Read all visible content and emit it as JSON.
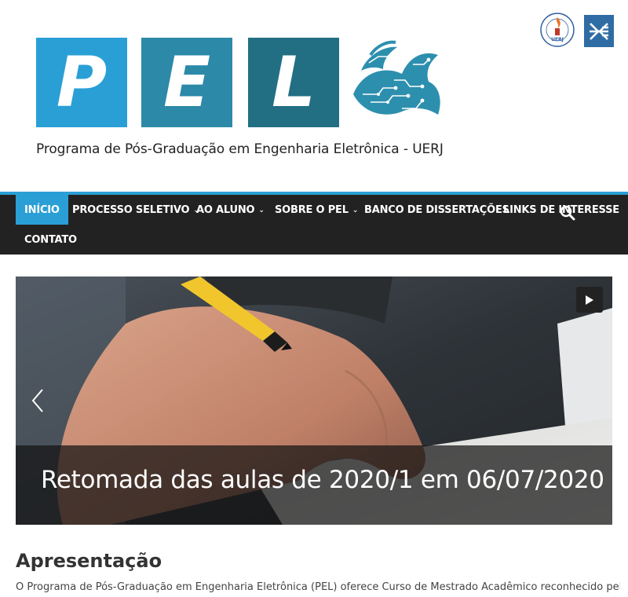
{
  "header": {
    "logo_letters": [
      "P",
      "E",
      "L"
    ],
    "subtitle": "Programa de Pós-Graduação em Engenharia Eletrônica - UERJ",
    "partner_logos": [
      "uerj-seal",
      "cte-logo"
    ],
    "uerj_seal_text": "UERJ",
    "colors": {
      "p": "#2a9fd6",
      "e": "#2c89a8",
      "l": "#226f84"
    }
  },
  "nav": {
    "items": [
      {
        "label": "INÍCIO",
        "active": true,
        "has_dropdown": false
      },
      {
        "label": "PROCESSO SELETIVO",
        "active": false,
        "has_dropdown": true
      },
      {
        "label": "AO ALUNO",
        "active": false,
        "has_dropdown": true
      },
      {
        "label": "SOBRE O PEL",
        "active": false,
        "has_dropdown": true
      },
      {
        "label": "BANCO DE DISSERTAÇÕES",
        "active": false,
        "has_dropdown": false
      },
      {
        "label": "LINKS DE INTERESSE",
        "active": false,
        "has_dropdown": false
      },
      {
        "label": "CONTATO",
        "active": false,
        "has_dropdown": false
      }
    ],
    "dropdown_glyph": "⌄",
    "search_icon": "search-icon",
    "accent": "#2a9fd6",
    "background": "#222222"
  },
  "slider": {
    "caption": "Retomada das aulas de 2020/1 em 06/07/2020",
    "controls": [
      "prev-arrow-icon",
      "play-icon"
    ]
  },
  "content": {
    "title": "Apresentação",
    "text": "O Programa de Pós-Graduação em Engenharia Eletrônica (PEL) oferece Curso de Mestrado Acadêmico reconhecido pela"
  }
}
